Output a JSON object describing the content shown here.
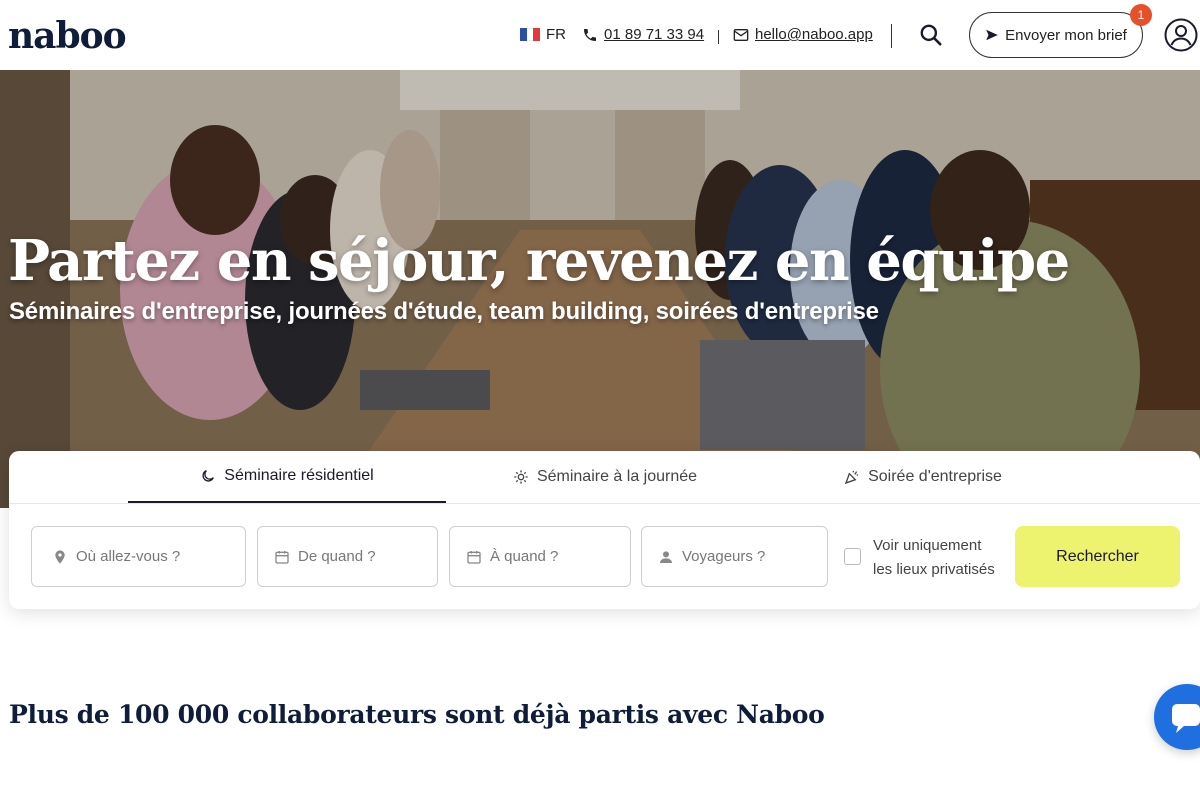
{
  "brand": {
    "logo_text": "naboo"
  },
  "header": {
    "language": "FR",
    "phone": "01 89 71 33 94",
    "email": "hello@naboo.app",
    "brief_label": "Envoyer mon brief",
    "notification_count": "1"
  },
  "hero": {
    "title": "Partez en séjour, revenez en équipe",
    "subtitle": "Séminaires d'entreprise, journées d'étude, team building, soirées d'entreprise"
  },
  "search": {
    "tabs": [
      {
        "label": "Séminaire résidentiel",
        "icon": "moon-icon",
        "active": true
      },
      {
        "label": "Séminaire à la journée",
        "icon": "sun-icon",
        "active": false
      },
      {
        "label": "Soirée d'entreprise",
        "icon": "party-icon",
        "active": false
      }
    ],
    "where_placeholder": "Où allez-vous ?",
    "from_placeholder": "De quand ?",
    "to_placeholder": "À quand ?",
    "travelers_placeholder": "Voyageurs ?",
    "private_line1": "Voir uniquement",
    "private_line2": "les lieux privatisés",
    "submit_label": "Rechercher"
  },
  "section": {
    "title": "Plus de 100 000 collaborateurs sont déjà partis avec Naboo"
  },
  "colors": {
    "accent": "#eef36f",
    "navy": "#0f1d3a",
    "chat": "#1f6fe0",
    "badge": "#e8502a"
  }
}
